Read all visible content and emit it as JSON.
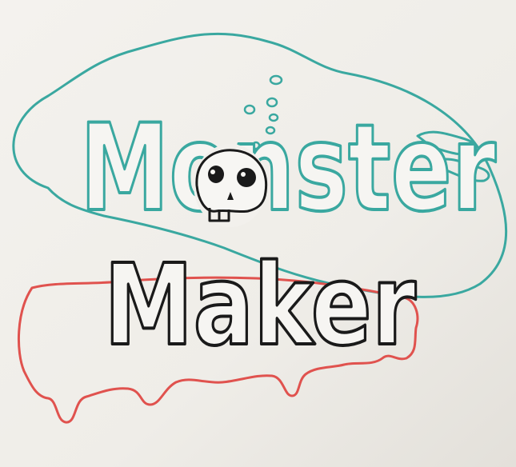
{
  "drawing": {
    "title_word_1": "Monster",
    "title_word_2": "Maker",
    "ink_colors": {
      "teal": "#3aa8a0",
      "black": "#1a1a1a",
      "red": "#e0524e",
      "paper": "#f2f0ec"
    },
    "icons": [
      "skull-icon",
      "bubble-icon"
    ]
  }
}
